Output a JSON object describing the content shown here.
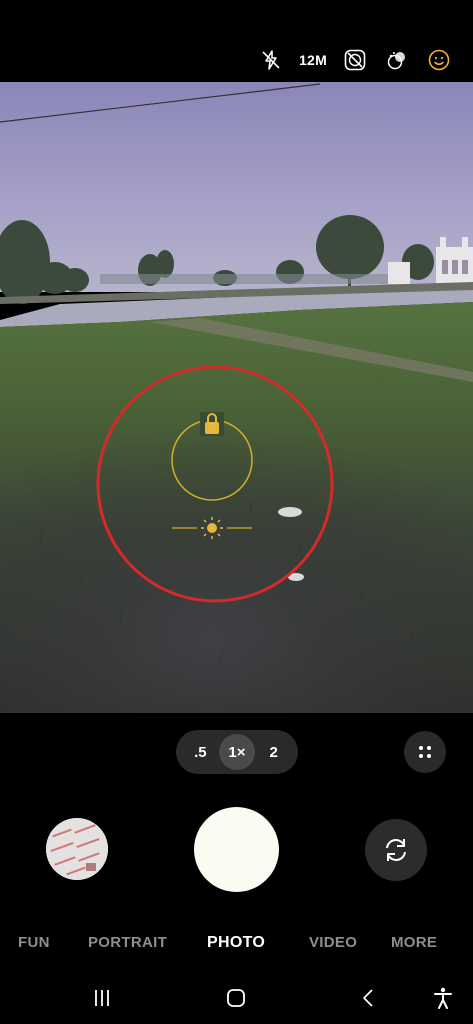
{
  "status_bar": {
    "resolution": "12M",
    "icons": [
      "flash-off-icon",
      "timer-off-icon",
      "filter-icon",
      "face-effects-icon"
    ]
  },
  "viewfinder": {
    "focus_ring_color": "#d42a2a",
    "af_lock_color": "#d7ae2a"
  },
  "zoom": {
    "options": [
      ".5",
      "1×",
      "2"
    ],
    "selected": "1×"
  },
  "controls": {
    "more_icon": "grid-dots-icon",
    "switch_icon": "rotate-camera-icon",
    "shutter_color": "#fbfbf2"
  },
  "modes": [
    {
      "label": "FUN"
    },
    {
      "label": "PORTRAIT"
    },
    {
      "label": "PHOTO",
      "active": true
    },
    {
      "label": "VIDEO"
    },
    {
      "label": "MORE"
    }
  ],
  "nav": [
    "recents-icon",
    "home-icon",
    "back-icon",
    "accessibility-icon"
  ]
}
